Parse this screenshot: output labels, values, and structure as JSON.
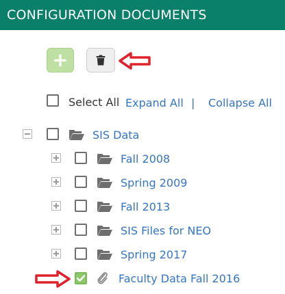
{
  "header": {
    "title": "CONFIGURATION DOCUMENTS"
  },
  "toolbar": {
    "add_label": "+"
  },
  "controls": {
    "select_all": "Select All",
    "expand_all": "Expand All",
    "separator": "|",
    "collapse_all": "Collapse All"
  },
  "tree": {
    "root": {
      "label": "SIS Data"
    },
    "children": [
      {
        "label": "Fall 2008"
      },
      {
        "label": "Spring 2009"
      },
      {
        "label": "Fall 2013"
      },
      {
        "label": "SIS Files for NEO"
      },
      {
        "label": "Spring 2017"
      }
    ],
    "file": {
      "label": "Faculty Data Fall 2016",
      "checked": true
    }
  },
  "colors": {
    "header_bg": "#0a7f6a",
    "link": "#3476c5",
    "add_button": "#bfe0a3",
    "checked": "#8dc86a",
    "annotation_arrow": "#e0202a"
  }
}
